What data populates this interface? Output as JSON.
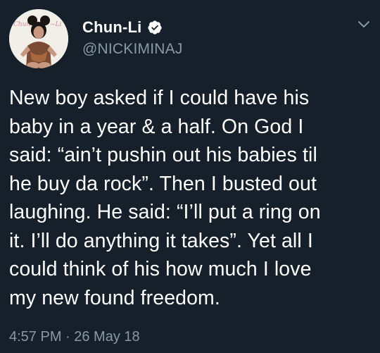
{
  "author": {
    "display_name": "Chun-Li",
    "handle": "@NICKIMINAJ",
    "verified": true,
    "avatar_icon": "profile-photo",
    "avatar_script": "Chun-Li"
  },
  "tweet": {
    "text": "New boy asked if I could have his\nbaby in a year & a half. On God I\nsaid: “ain’t pushin out his babies til\nhe buy da rock”. Then I busted out\nlaughing. He said: “I’ll put a ring on\nit. I’ll do anything it takes”. Yet all I\ncould think of his how much I love\nmy new found freedom.",
    "timestamp": "4:57 PM · 26 May 18"
  },
  "colors": {
    "background": "#15202b",
    "text_primary": "#ffffff",
    "text_secondary": "#8899a6",
    "verified_badge": "#ffffff"
  },
  "icons": {
    "verified": "verified-badge-icon",
    "menu": "chevron-down-icon"
  }
}
